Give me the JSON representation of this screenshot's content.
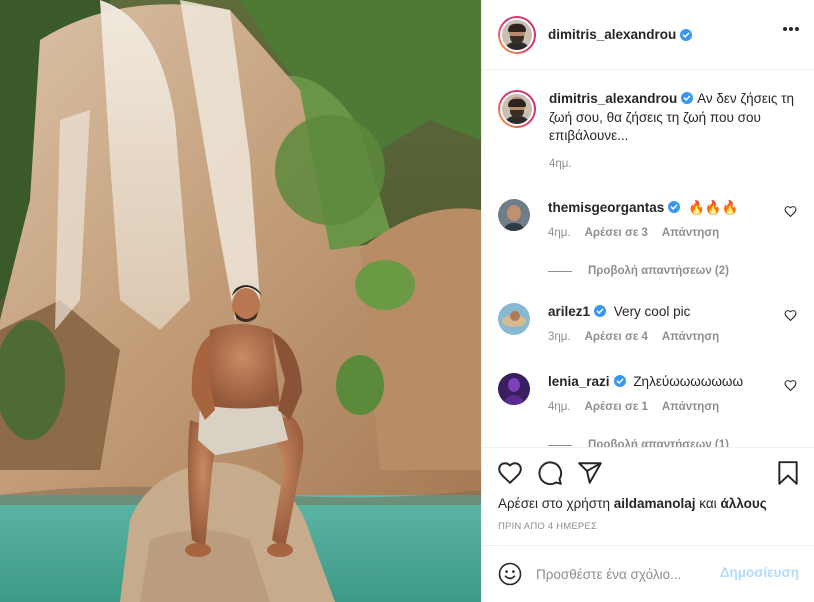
{
  "header": {
    "username": "dimitris_alexandrou",
    "verified_icon": "verified-badge-icon",
    "more_icon": "more-options-icon"
  },
  "caption": {
    "username": "dimitris_alexandrou",
    "text": "Αν δεν ζήσεις τη ζωή σου, θα ζήσεις τη ζωή που σου επιβάλουνε...",
    "time": "4ημ."
  },
  "comments": [
    {
      "username": "themisgeorgantas",
      "text": "🔥🔥🔥",
      "time": "4ημ.",
      "likes": "Αρέσει σε 3",
      "reply": "Απάντηση",
      "view_replies": "Προβολή απαντήσεων (2)"
    },
    {
      "username": "arilez1",
      "text": "Very cool pic",
      "time": "3ημ.",
      "likes": "Αρέσει σε 4",
      "reply": "Απάντηση"
    },
    {
      "username": "lenia_razi",
      "text": "Ζηλεύωωωωωωω",
      "time": "4ημ.",
      "likes": "Αρέσει σε 1",
      "reply": "Απάντηση",
      "view_replies": "Προβολή απαντήσεων (1)"
    }
  ],
  "actions": {
    "liked_by_prefix": "Αρέσει στο χρήστη",
    "liked_by_user": "aildamanolaj",
    "liked_by_conj": "και",
    "liked_by_others": "άλλους",
    "date": "ΠΡΙΝ ΑΠΟ 4 ΗΜΕΡΕΣ"
  },
  "add_comment": {
    "placeholder": "Προσθέστε ένα σχόλιο...",
    "post_label": "Δημοσίευση",
    "emoji_icon": "emoji-icon"
  },
  "colors": {
    "verified": "#3897f0",
    "text": "#262626",
    "muted": "#8e8e8e",
    "post_disabled": "#b3dbff",
    "border": "#efefef"
  }
}
